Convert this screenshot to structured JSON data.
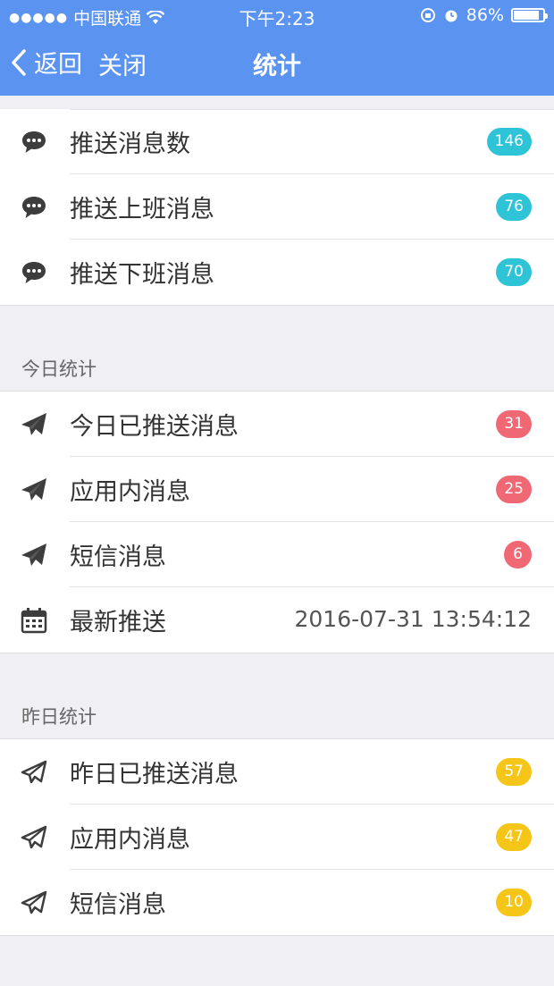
{
  "status_bar": {
    "carrier": "中国联通",
    "time": "下午2:23",
    "battery": "86%",
    "battery_level": 0.86
  },
  "nav": {
    "back_label": "返回",
    "close_label": "关闭",
    "title": "统计"
  },
  "push_stats": [
    {
      "label": "推送消息数",
      "count": "146"
    },
    {
      "label": "推送上班消息",
      "count": "76"
    },
    {
      "label": "推送下班消息",
      "count": "70"
    }
  ],
  "today": {
    "header": "今日统计",
    "items": [
      {
        "label": "今日已推送消息",
        "count": "31"
      },
      {
        "label": "应用内消息",
        "count": "25"
      },
      {
        "label": "短信消息",
        "count": "6"
      }
    ],
    "latest": {
      "label": "最新推送",
      "value": "2016-07-31 13:54:12"
    }
  },
  "yesterday": {
    "header": "昨日统计",
    "items": [
      {
        "label": "昨日已推送消息",
        "count": "57"
      },
      {
        "label": "应用内消息",
        "count": "47"
      },
      {
        "label": "短信消息",
        "count": "10"
      }
    ]
  },
  "colors": {
    "nav_bg": "#5b93f0",
    "badge_teal": "#2ec3d6",
    "badge_red": "#ef6873",
    "badge_yellow": "#f5c518"
  }
}
